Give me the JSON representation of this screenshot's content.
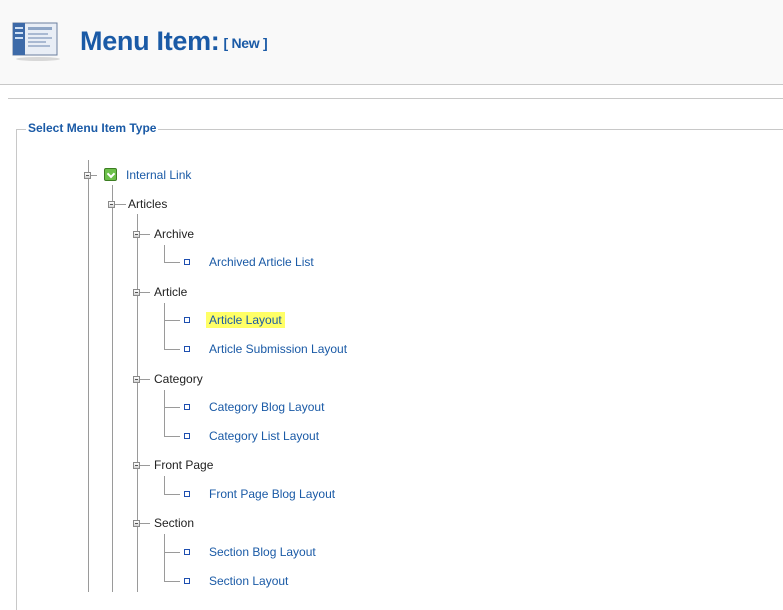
{
  "header": {
    "title": "Menu Item:",
    "title_tag": "[ New ]",
    "icon": "menu-item-icon"
  },
  "section": {
    "legend": "Select Menu Item Type"
  },
  "tree": {
    "root": {
      "label": "Internal Link",
      "icon": "internal-link-icon"
    },
    "articles": {
      "label": "Articles"
    },
    "groups": [
      {
        "label": "Archive",
        "items": [
          "Archived Article List"
        ]
      },
      {
        "label": "Article",
        "items": [
          "Article Layout",
          "Article Submission Layout"
        ]
      },
      {
        "label": "Category",
        "items": [
          "Category Blog Layout",
          "Category List Layout"
        ]
      },
      {
        "label": "Front Page",
        "items": [
          "Front Page Blog Layout"
        ]
      },
      {
        "label": "Section",
        "items": [
          "Section Blog Layout",
          "Section Layout"
        ]
      }
    ],
    "highlighted_item": "Article Layout"
  },
  "colors": {
    "link": "#1a5aa6",
    "highlight": "#ffff66"
  }
}
